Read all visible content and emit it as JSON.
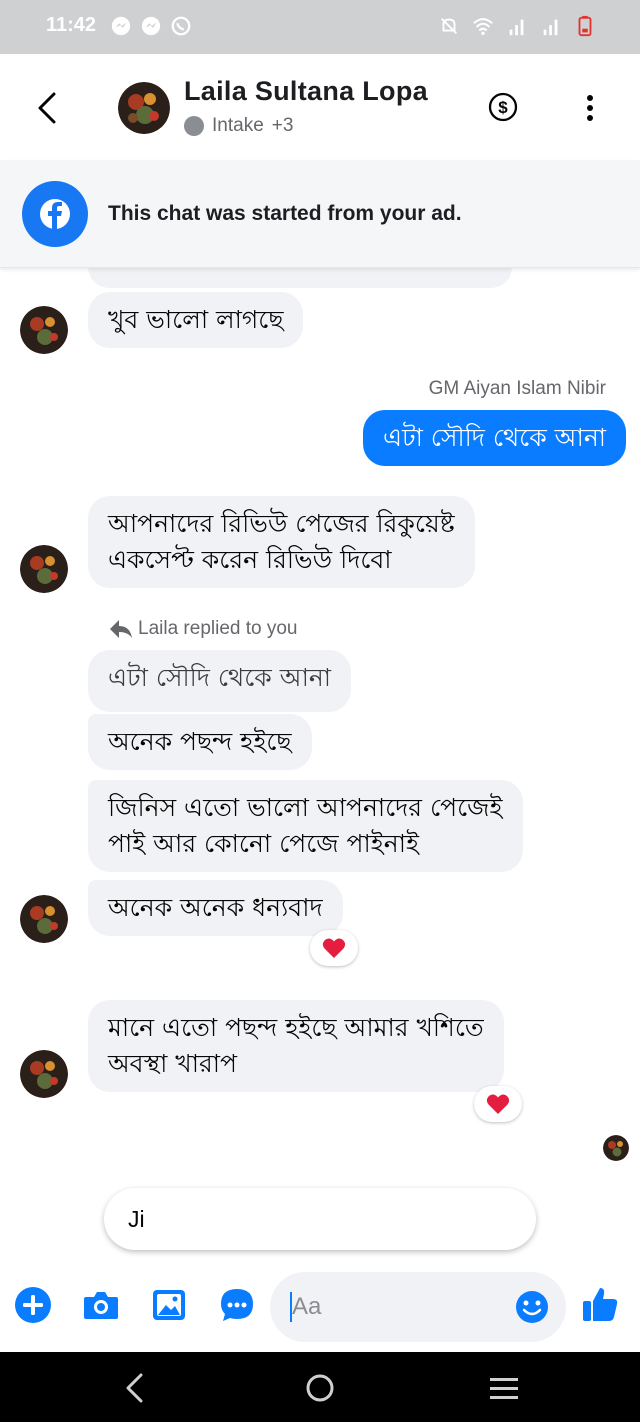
{
  "status_bar": {
    "time": "11:42",
    "left_icons": [
      "messenger-notification-icon",
      "messenger-notification-icon",
      "whatsapp-icon"
    ],
    "right_icons": [
      "mute-icon",
      "wifi-icon",
      "signal-icon",
      "signal-icon",
      "battery-low-icon"
    ]
  },
  "header": {
    "name": "Laila Sultana Lopa",
    "status_label": "Intake",
    "status_extra": "+3"
  },
  "ad_banner": {
    "text": "This chat was started from your ad."
  },
  "messages": {
    "m1": "খুব ভালো লাগছে",
    "sender_label": "GM Aiyan Islam Nibir",
    "m2": "এটা সৌদি থেকে আনা",
    "m3": "আপনাদের রিভিউ পেজের রিকুয়েষ্ট\nএকসেপ্ট করেন রিভিউ দিবো",
    "reply_label": "Laila replied to you",
    "quoted": "এটা সৌদি থেকে আনা",
    "m4": "অনেক পছন্দ হইছে",
    "m5": "জিনিস এতো ভালো আপনাদের পেজেই\nপাই আর কোনো পেজে পাইনাই",
    "m6": "অনেক অনেক ধন্যবাদ",
    "m7": "মানে এতো পছন্দ হইছে আমার খশিতে\nঅবস্থা খারাপ",
    "reaction": "❤️"
  },
  "quick_reply": "Ji",
  "composer": {
    "placeholder": "Aa"
  },
  "colors": {
    "accent": "#0a7cff",
    "incoming_bubble": "#f0f2f5",
    "status_bar": "#cfd0d2",
    "reaction_heart": "#e41e3f"
  }
}
